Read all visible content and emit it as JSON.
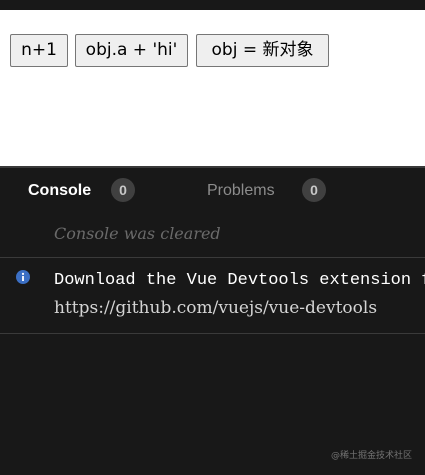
{
  "preview": {
    "buttons": [
      {
        "label": "n+1"
      },
      {
        "label": "obj.a + 'hi'"
      },
      {
        "label": "obj = 新对象"
      }
    ]
  },
  "panel": {
    "tabs": [
      {
        "label": "Console",
        "count": "0",
        "active": true
      },
      {
        "label": "Problems",
        "count": "0",
        "active": false
      }
    ],
    "cleared_message": "Console was cleared",
    "messages": [
      {
        "icon": "info-icon",
        "line1": "Download the Vue Devtools extension fo",
        "line2": "https://github.com/vuejs/vue-devtools"
      }
    ]
  },
  "watermark": "@稀土掘金技术社区",
  "colors": {
    "panel_bg": "#181818",
    "info_icon": "#3b6fc4",
    "active_tab": "#ffffff",
    "inactive_tab": "#8c8c8c"
  }
}
